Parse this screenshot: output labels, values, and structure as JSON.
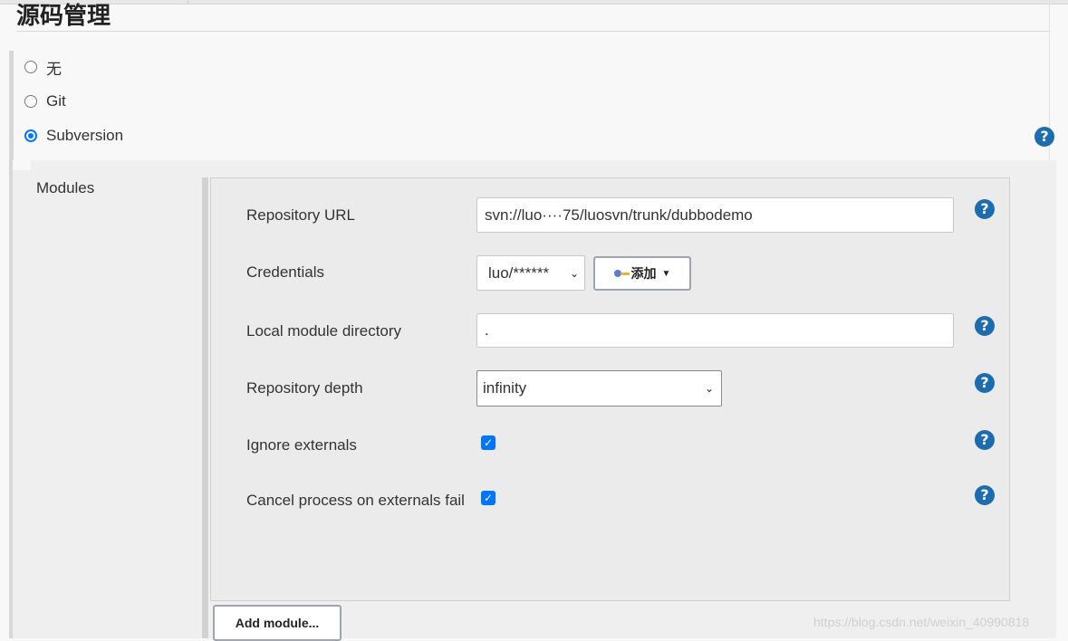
{
  "section": {
    "title": "源码管理"
  },
  "scm_options": [
    {
      "label": "无",
      "selected": false
    },
    {
      "label": "Git",
      "selected": false
    },
    {
      "label": "Subversion",
      "selected": true
    }
  ],
  "modules": {
    "label": "Modules",
    "fields": {
      "repository_url": {
        "label": "Repository URL",
        "value": "svn://luo····75/luosvn/trunk/dubbodemo"
      },
      "credentials": {
        "label": "Credentials",
        "value": "luo/******",
        "add_label": "添加"
      },
      "local_module_directory": {
        "label": "Local module directory",
        "value": "."
      },
      "repository_depth": {
        "label": "Repository depth",
        "value": "infinity"
      },
      "ignore_externals": {
        "label": "Ignore externals",
        "checked": true
      },
      "cancel_process": {
        "label": "Cancel process on externals fail",
        "checked": true
      }
    },
    "add_module_label": "Add module..."
  },
  "icons": {
    "help": "help-icon",
    "help_glyph": "?",
    "check_glyph": "✓",
    "chevron_glyph": "⌄",
    "caret_glyph": "▼"
  },
  "colors": {
    "help_blue": "#1c6cb0",
    "accent": "#0075ff"
  },
  "watermark": "https://blog.csdn.net/weixin_40990818"
}
